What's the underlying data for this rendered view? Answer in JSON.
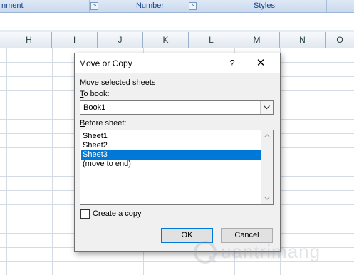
{
  "ribbon": {
    "groups": [
      "nment",
      "Number",
      "Styles"
    ]
  },
  "columns": [
    "H",
    "I",
    "J",
    "K",
    "L",
    "M",
    "N",
    "O"
  ],
  "dialog": {
    "title": "Move or Copy",
    "help_label": "?",
    "close_label": "✕",
    "move_label": "Move selected sheets",
    "to_book_label_underlined": "T",
    "to_book_label_rest": "o book:",
    "to_book_value": "Book1",
    "before_sheet_label_underlined": "B",
    "before_sheet_label_rest": "efore sheet:",
    "sheets": [
      "Sheet1",
      "Sheet2",
      "Sheet3",
      "(move to end)"
    ],
    "selected_sheet": "Sheet3",
    "create_copy_label_underlined": "C",
    "create_copy_label_rest": "reate a copy",
    "create_copy_checked": false,
    "ok_label": "OK",
    "cancel_label": "Cancel"
  },
  "watermark": {
    "text": "uantrimang"
  },
  "colors": {
    "selection": "#0078d7",
    "ribbon_text": "#15428b"
  }
}
